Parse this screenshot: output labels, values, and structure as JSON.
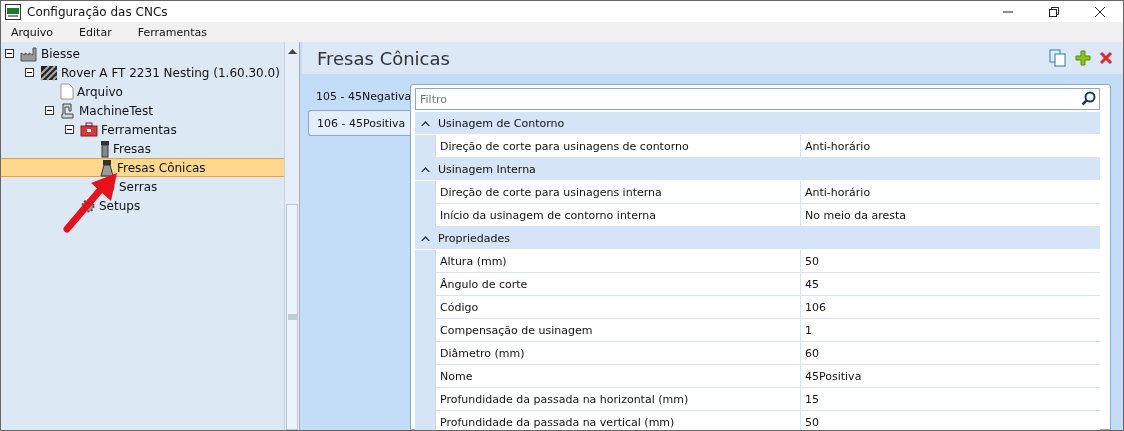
{
  "window": {
    "title": "Configuração das CNCs"
  },
  "menu": [
    "Arquivo",
    "Editar",
    "Ferramentas"
  ],
  "tree": [
    {
      "label": "Biesse",
      "kind": "factory",
      "expanded": true,
      "selected": false,
      "children": [
        {
          "label": "Rover A FT 2231 Nesting (1.60.30.0)",
          "kind": "machine",
          "expanded": true,
          "selected": false,
          "children": [
            {
              "label": "Arquivo",
              "kind": "file",
              "selected": false
            },
            {
              "label": "MachineTest",
              "kind": "press",
              "expanded": true,
              "selected": false,
              "children": [
                {
                  "label": "Ferramentas",
                  "kind": "toolbox",
                  "expanded": true,
                  "selected": false,
                  "children": [
                    {
                      "label": "Fresas",
                      "kind": "mill",
                      "selected": false
                    },
                    {
                      "label": "Fresas Cônicas",
                      "kind": "conemill",
                      "selected": true
                    },
                    {
                      "label": "Serras",
                      "kind": "saw",
                      "selected": false
                    }
                  ]
                },
                {
                  "label": "Setups",
                  "kind": "gear",
                  "selected": false
                }
              ]
            }
          ]
        }
      ]
    }
  ],
  "panel": {
    "title": "Fresas Cônicas",
    "tabs": [
      {
        "label": "105 - 45Negativa",
        "selected": false
      },
      {
        "label": "106 - 45Positiva",
        "selected": true
      }
    ],
    "filter": {
      "placeholder": "Filtro"
    },
    "groups": [
      {
        "title": "Usinagem de Contorno",
        "expanded": true,
        "rows": [
          {
            "name": "Direção de corte para usinagens de contorno",
            "value": "Anti-horário"
          }
        ]
      },
      {
        "title": "Usinagem Interna",
        "expanded": true,
        "rows": [
          {
            "name": "Direção de corte para usinagens interna",
            "value": "Anti-horário"
          },
          {
            "name": "Início da usinagem de contorno interna",
            "value": "No meio da aresta"
          }
        ]
      },
      {
        "title": "Propriedades",
        "expanded": true,
        "rows": [
          {
            "name": "Altura (mm)",
            "value": "50"
          },
          {
            "name": "Ângulo de corte",
            "value": "45"
          },
          {
            "name": "Código",
            "value": "106"
          },
          {
            "name": "Compensação de usinagem",
            "value": "1"
          },
          {
            "name": "Diâmetro (mm)",
            "value": "60"
          },
          {
            "name": "Nome",
            "value": "45Positiva"
          },
          {
            "name": "Profundidade da passada na horizontal (mm)",
            "value": "15"
          },
          {
            "name": "Profundidade da passada na vertical (mm)",
            "value": "50"
          }
        ]
      }
    ]
  }
}
